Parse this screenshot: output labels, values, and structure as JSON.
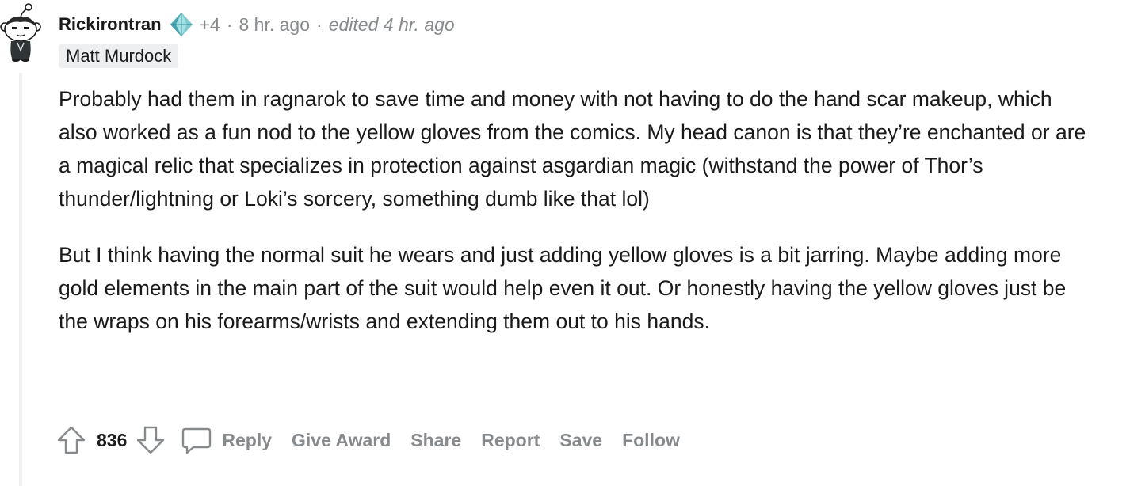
{
  "comment": {
    "author": "Rickirontran",
    "karma_change": "+4",
    "posted": "8 hr. ago",
    "edited": "edited 4 hr. ago",
    "flair": "Matt Murdock",
    "paragraphs": [
      "Probably had them in ragnarok to save time and money with not having to do the hand scar makeup, which also worked as a fun nod to the yellow gloves from the comics. My head canon is that they’re enchanted or are a magical relic that specializes in protection against asgardian magic (withstand the power of Thor’s thunder/lightning or Loki’s sorcery, something dumb like that lol)",
      "But I think having the normal suit he wears and just adding yellow gloves is a bit jarring. Maybe adding more gold elements in the main part of the suit would help even it out. Or honestly having the yellow gloves just be the wraps on his forearms/wrists and extending them out to his hands."
    ],
    "score": "836"
  },
  "actions": {
    "reply": "Reply",
    "give_award": "Give Award",
    "share": "Share",
    "report": "Report",
    "save": "Save",
    "follow": "Follow"
  },
  "separator": "·",
  "colors": {
    "meta_gray": "#878a8c",
    "text": "#1a1a1b",
    "flair_bg": "#edeff1",
    "thread_line": "#edeff1"
  },
  "icons": {
    "avatar": "snoo-avatar",
    "achievement": "diamond-badge-icon",
    "upvote": "upvote-arrow-icon",
    "downvote": "downvote-arrow-icon",
    "comment": "speech-bubble-icon"
  }
}
